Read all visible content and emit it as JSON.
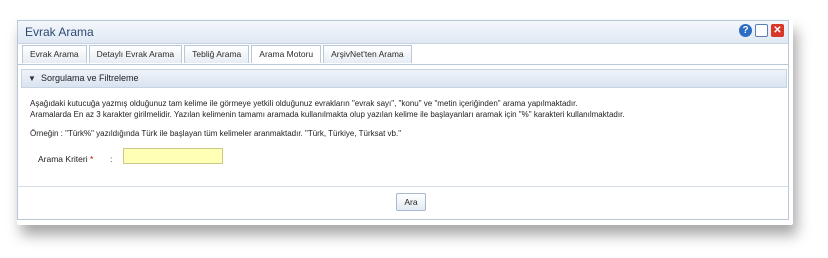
{
  "window": {
    "title": "Evrak Arama",
    "icons": [
      "help-icon",
      "monitor-icon",
      "close-icon"
    ]
  },
  "tabs": [
    {
      "label": "Evrak Arama",
      "active": false
    },
    {
      "label": "Detaylı Evrak Arama",
      "active": false
    },
    {
      "label": "Tebliğ Arama",
      "active": false
    },
    {
      "label": "Arama Motoru",
      "active": true
    },
    {
      "label": "ArşivNet'ten Arama",
      "active": false
    }
  ],
  "section": {
    "title": "Sorgulama ve Filtreleme"
  },
  "content": {
    "line1": "Aşağıdaki kutucuğa yazmış olduğunuz tam kelime ile görmeye yetkili olduğunuz evrakların \"evrak sayı\", \"konu\" ve \"metin içeriğinden\" arama yapılmaktadır.",
    "line2": "Aramalarda En az 3 karakter girilmelidir. Yazılan kelimenin tamamı aramada kullanılmakta olup yazılan kelime ile başlayanları aramak için \"%\" karakteri kullanılmaktadır.",
    "example": "Örneğin : \"Türk%\" yazıldığında Türk ile başlayan tüm kelimeler aranmaktadır. \"Türk, Türkiye, Türksat vb.\""
  },
  "form": {
    "label": "Arama Kriteri",
    "required_mark": "*",
    "colon": ":",
    "value": ""
  },
  "button": {
    "label": "Ara"
  },
  "colors": {
    "accent": "#2d4b73",
    "input_bg": "#ffffb5",
    "close": "#d9362a"
  }
}
